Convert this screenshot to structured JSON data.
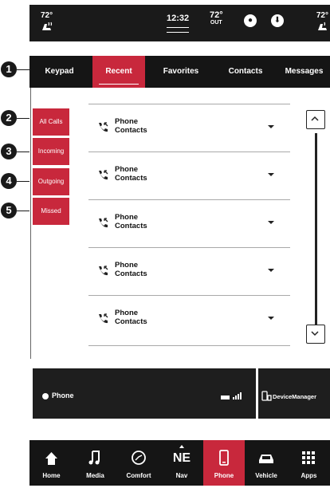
{
  "status_bar": {
    "temp_left": "72°",
    "seat_left_icon": "seat-heat-icon",
    "clock": "12:32",
    "outside_temp": "72°",
    "outside_label": "OUT",
    "temp_right": "72°",
    "seat_right_icon": "seat-heat-icon"
  },
  "tabs": [
    {
      "label": "Keypad",
      "active": false
    },
    {
      "label": "Recent",
      "active": true
    },
    {
      "label": "Favorites",
      "active": false
    },
    {
      "label": "Contacts",
      "active": false
    },
    {
      "label": "Messages",
      "active": false
    }
  ],
  "filters": [
    {
      "label": "All Calls"
    },
    {
      "label": "Incoming"
    },
    {
      "label": "Outgoing"
    },
    {
      "label": "Missed"
    }
  ],
  "calls": [
    {
      "title": "Phone",
      "subtitle": "Contacts",
      "icon": "phone-incoming-icon"
    },
    {
      "title": "Phone",
      "subtitle": "Contacts",
      "icon": "phone-incoming-icon"
    },
    {
      "title": "Phone",
      "subtitle": "Contacts",
      "icon": "phone-incoming-icon"
    },
    {
      "title": "Phone",
      "subtitle": "Contacts",
      "icon": "phone-incoming-icon"
    },
    {
      "title": "Phone",
      "subtitle": "Contacts",
      "icon": "phone-incoming-icon"
    }
  ],
  "phone_status": {
    "label": "Phone",
    "device_manager": "DeviceManager"
  },
  "nav": [
    {
      "label": "Home",
      "icon": "home-icon"
    },
    {
      "label": "Media",
      "icon": "music-note-icon"
    },
    {
      "label": "Comfort",
      "icon": "climate-icon"
    },
    {
      "label": "Nav",
      "icon": "compass-icon",
      "text": "NE"
    },
    {
      "label": "Phone",
      "icon": "phone-icon",
      "active": true
    },
    {
      "label": "Vehicle",
      "icon": "car-icon"
    },
    {
      "label": "Apps",
      "icon": "apps-grid-icon"
    }
  ],
  "callouts": [
    "1",
    "2",
    "3",
    "4",
    "5"
  ],
  "colors": {
    "accent": "#c8283c",
    "bar": "#151515",
    "text": "#111111"
  }
}
